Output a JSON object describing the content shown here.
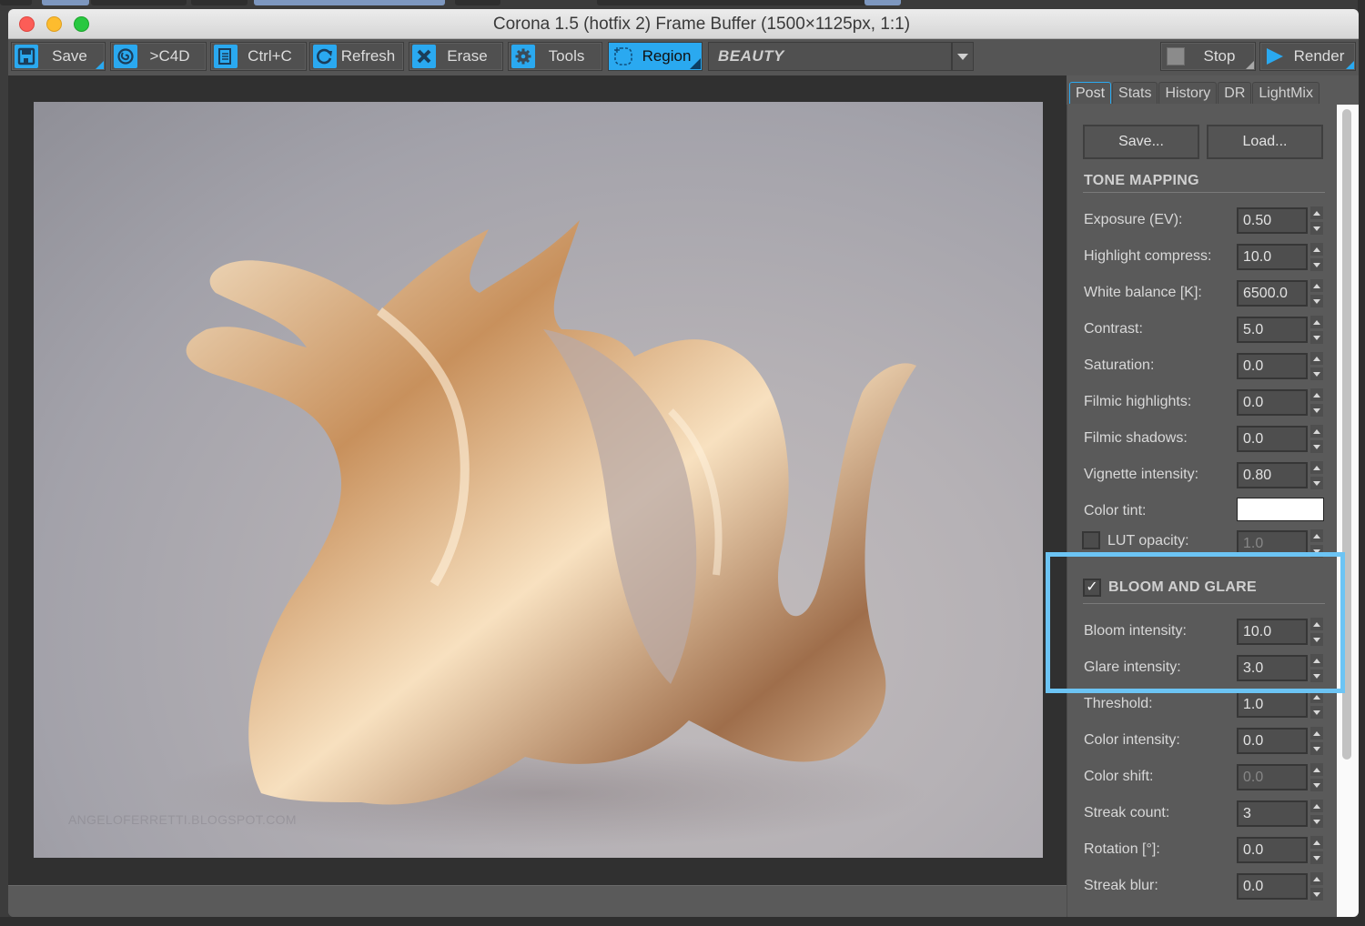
{
  "window": {
    "title": "Corona 1.5 (hotfix 2) Frame Buffer (1500×1125px, 1:1)"
  },
  "toolbar": {
    "buttons": [
      {
        "label": "Save",
        "icon": "floppy-disk-icon"
      },
      {
        "label": ">C4D",
        "icon": "cinema4d-icon"
      },
      {
        "label": "Ctrl+C",
        "icon": "clipboard-copy-icon"
      },
      {
        "label": "Refresh",
        "icon": "refresh-icon"
      },
      {
        "label": "Erase",
        "icon": "erase-x-icon"
      },
      {
        "label": "Tools",
        "icon": "gear-icon"
      },
      {
        "label": "Region",
        "icon": "region-select-icon",
        "active": true
      }
    ],
    "channel_select": {
      "value": "BEAUTY"
    },
    "stop_label": "Stop",
    "render_label": "Render"
  },
  "viewport": {
    "watermark": "ANGELOFERRETTI.BLOGSPOT.COM",
    "image_subject": "Rendered metallic rose-gold dragon on grey backdrop"
  },
  "side_panel": {
    "tabs": [
      "Post",
      "Stats",
      "History",
      "DR",
      "LightMix"
    ],
    "active_tab": "Post",
    "save_button": "Save...",
    "load_button": "Load...",
    "tone_mapping": {
      "title": "TONE MAPPING",
      "fields": [
        {
          "label": "Exposure (EV):",
          "value": "0.50"
        },
        {
          "label": "Highlight compress:",
          "value": "10.0"
        },
        {
          "label": "White balance [K]:",
          "value": "6500.0"
        },
        {
          "label": "Contrast:",
          "value": "5.0"
        },
        {
          "label": "Saturation:",
          "value": "0.0"
        },
        {
          "label": "Filmic highlights:",
          "value": "0.0"
        },
        {
          "label": "Filmic shadows:",
          "value": "0.0"
        },
        {
          "label": "Vignette intensity:",
          "value": "0.80"
        }
      ],
      "color_tint_label": "Color tint:",
      "color_tint_value": "#ffffff",
      "lut_label": "LUT opacity:",
      "lut_value": "1.0",
      "lut_enabled": false
    },
    "bloom_glare": {
      "title": "BLOOM AND GLARE",
      "enabled": true,
      "fields": [
        {
          "label": "Bloom intensity:",
          "value": "10.0"
        },
        {
          "label": "Glare intensity:",
          "value": "3.0"
        },
        {
          "label": "Threshold:",
          "value": "1.0"
        },
        {
          "label": "Color intensity:",
          "value": "0.0"
        },
        {
          "label": "Color shift:",
          "value": "0.0",
          "disabled": true
        },
        {
          "label": "Streak count:",
          "value": "3"
        },
        {
          "label": "Rotation [°]:",
          "value": "0.0"
        },
        {
          "label": "Streak blur:",
          "value": "0.0"
        }
      ]
    }
  },
  "colors": {
    "accent": "#2aa9f0",
    "highlight_box": "#6cc4f4"
  }
}
